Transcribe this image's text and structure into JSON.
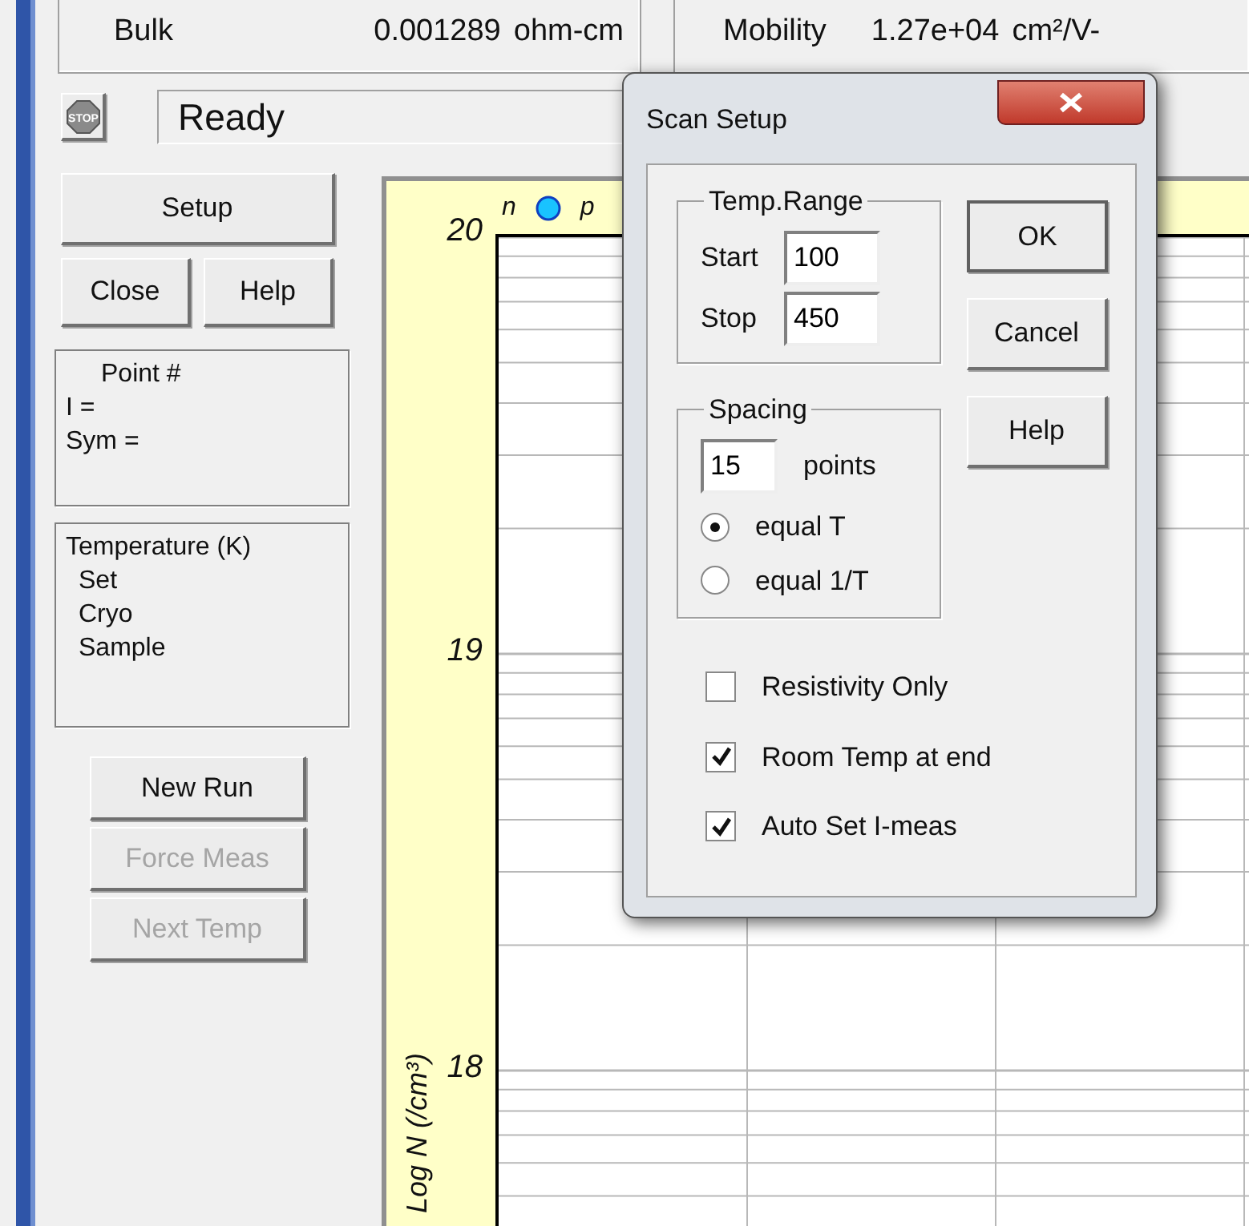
{
  "readouts": [
    {
      "label": "Bulk",
      "value": "0.001289",
      "unit": "ohm-cm"
    },
    {
      "label": "Mobility",
      "value": "1.27e+04",
      "unit": "cm²/V-"
    }
  ],
  "status": {
    "stop_label": "STOP",
    "text": "Ready"
  },
  "setup_button": "Setup",
  "close_button": "Close",
  "help_button": "Help",
  "point_panel": {
    "title": "Point #",
    "lines": [
      "I =",
      "Sym ="
    ]
  },
  "temperature_panel": {
    "title": "Temperature (K)",
    "lines": [
      "Set",
      "Cryo",
      "Sample"
    ]
  },
  "run_buttons": [
    {
      "label": "New Run",
      "disabled": false
    },
    {
      "label": "Force Meas",
      "disabled": true
    },
    {
      "label": "Next Temp",
      "disabled": true
    }
  ],
  "plot": {
    "y_label": "Log N (/cm³)",
    "y_ticks": [
      "20",
      "19",
      "18"
    ],
    "legend": [
      {
        "label": "n",
        "color": "#19c3ff"
      },
      {
        "label": "p"
      }
    ]
  },
  "dialog": {
    "title": "Scan Setup",
    "temp_range": {
      "title": "Temp.Range",
      "fields": [
        {
          "label": "Start",
          "value": "100"
        },
        {
          "label": "Stop",
          "value": "450"
        }
      ]
    },
    "spacing": {
      "title": "Spacing",
      "count": "15",
      "unit": "points",
      "options": [
        {
          "label": "equal T",
          "selected": true
        },
        {
          "label": "equal 1/T",
          "selected": false
        }
      ]
    },
    "checkboxes": [
      {
        "label": "Resistivity Only",
        "checked": false
      },
      {
        "label": "Room Temp at end",
        "checked": true
      },
      {
        "label": "Auto Set I-meas",
        "checked": true
      }
    ],
    "buttons": [
      "OK",
      "Cancel",
      "Help"
    ]
  }
}
